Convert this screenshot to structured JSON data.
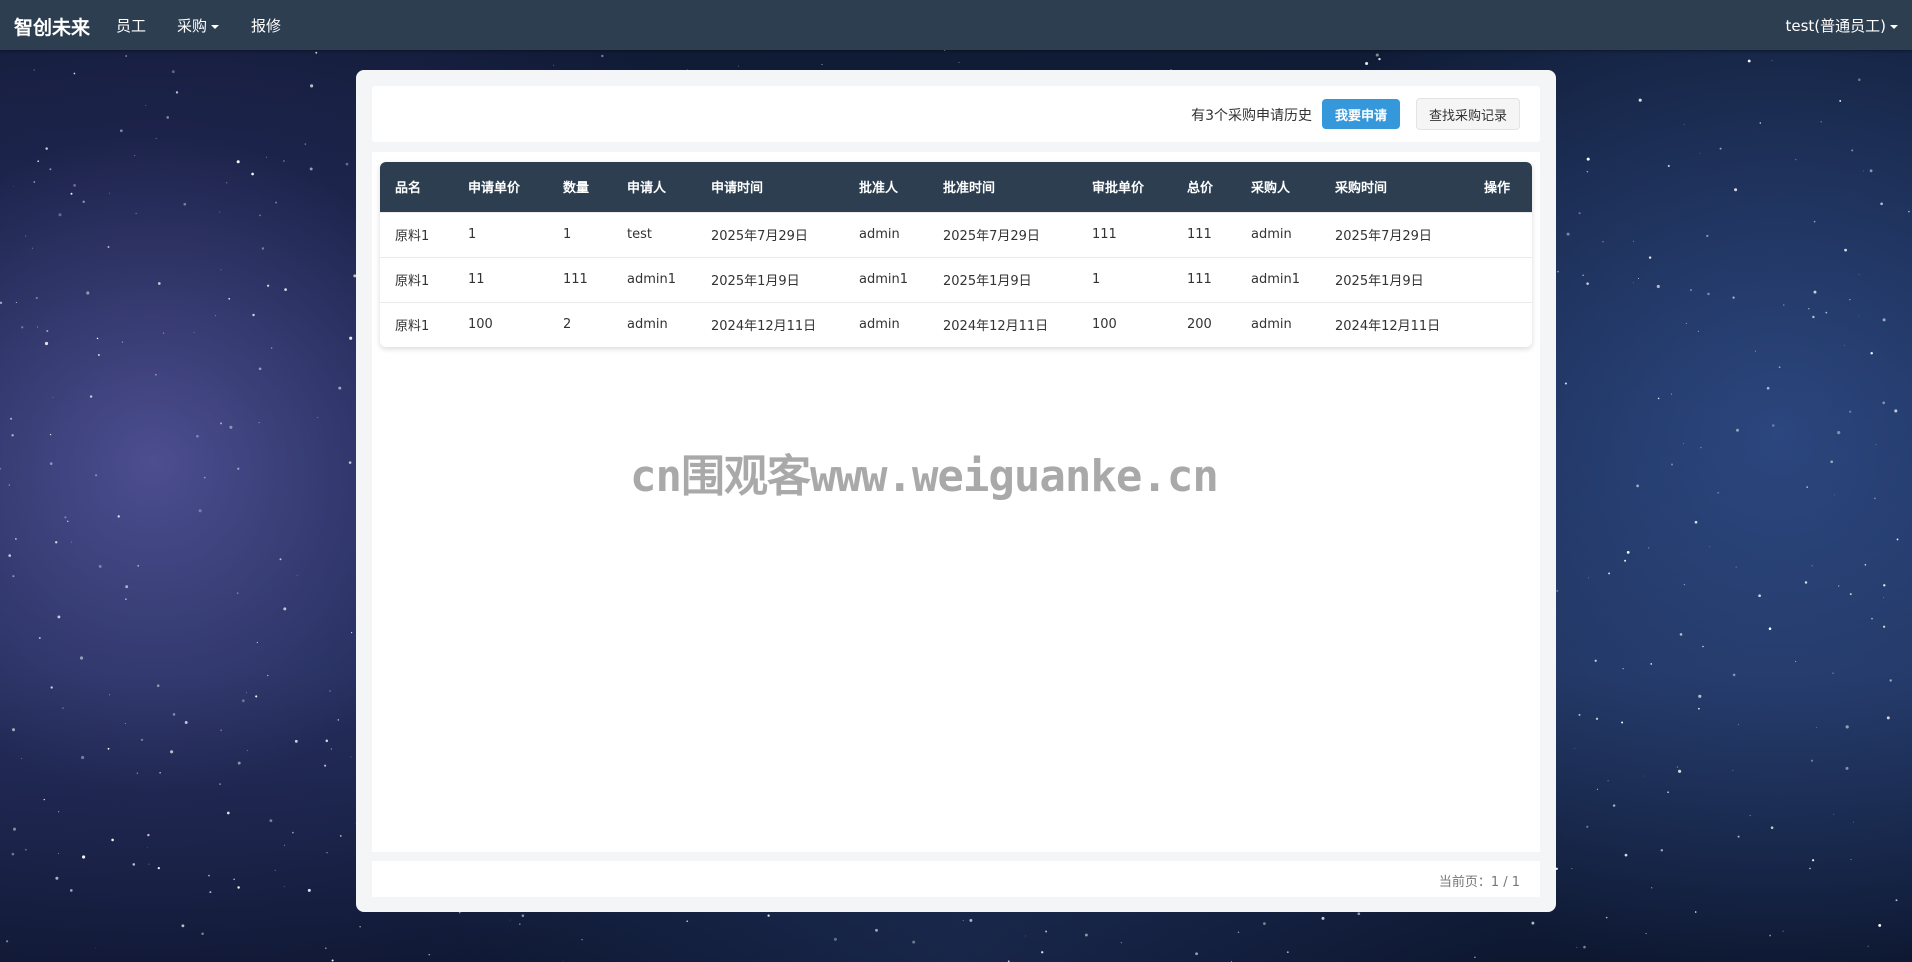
{
  "navbar": {
    "brand": "智创未来",
    "items": [
      {
        "label": "员工"
      },
      {
        "label": "采购"
      },
      {
        "label": "报修"
      }
    ],
    "user": "test(普通员工)"
  },
  "toolbar": {
    "history_text": "有3个采购申请历史",
    "apply_button": "我要申请",
    "search_button": "查找采购记录"
  },
  "table": {
    "headers": [
      "品名",
      "申请单价",
      "数量",
      "申请人",
      "申请时间",
      "批准人",
      "批准时间",
      "审批单价",
      "总价",
      "采购人",
      "采购时间",
      "操作"
    ],
    "rows": [
      [
        "原料1",
        "1",
        "1",
        "test",
        "2025年7月29日",
        "admin",
        "2025年7月29日",
        "111",
        "111",
        "admin",
        "2025年7月29日",
        ""
      ],
      [
        "原料1",
        "11",
        "111",
        "admin1",
        "2025年1月9日",
        "admin1",
        "2025年1月9日",
        "1",
        "111",
        "admin1",
        "2025年1月9日",
        ""
      ],
      [
        "原料1",
        "100",
        "2",
        "admin",
        "2024年12月11日",
        "admin",
        "2024年12月11日",
        "100",
        "200",
        "admin",
        "2024年12月11日",
        ""
      ]
    ]
  },
  "pager": {
    "text": "当前页：1 / 1"
  },
  "watermark": "cn围观客www.weiguanke.cn",
  "colors": {
    "navbar": "#2c3e50",
    "primary": "#3498db",
    "table_header": "#2c3e50"
  }
}
